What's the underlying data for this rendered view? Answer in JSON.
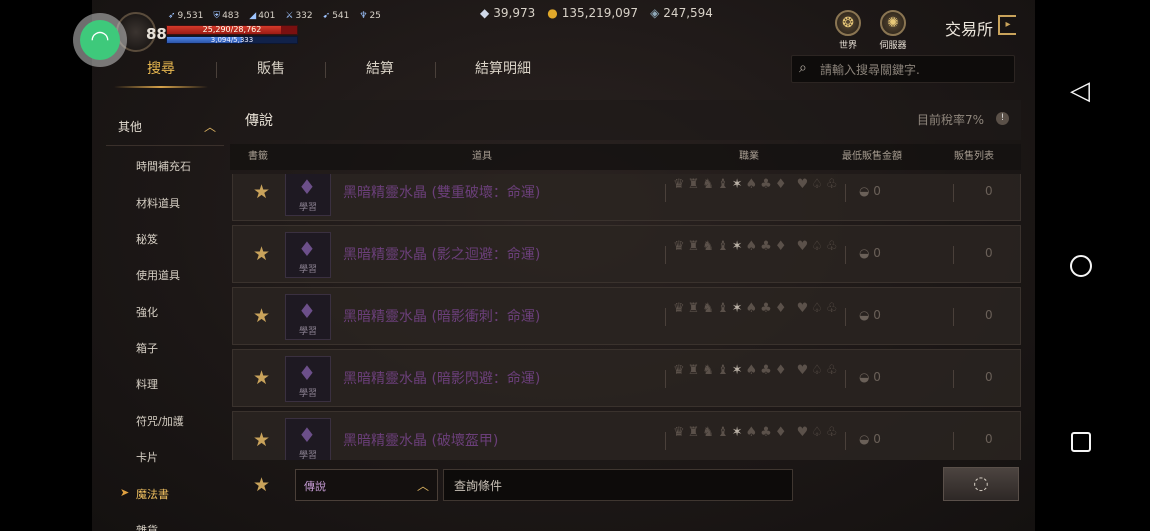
{
  "player": {
    "level": "88",
    "stats": [
      "9,531",
      "483",
      "401",
      "332",
      "541",
      "25"
    ],
    "hp_text": "25,290/28,762",
    "mp_text": "3,094/5,333",
    "hp_fraction": 0.88,
    "mp_fraction": 0.58
  },
  "currency": {
    "diamond": "39,973",
    "gold": "135,219,097",
    "gem": "247,594"
  },
  "top_right": {
    "world_label": "世界",
    "server_label": "伺服器",
    "title": "交易所"
  },
  "tabs": [
    "搜尋",
    "販售",
    "結算",
    "結算明細"
  ],
  "active_tab": 0,
  "search": {
    "placeholder": "請輸入搜尋關鍵字."
  },
  "sidebar": {
    "category": "其他",
    "items": [
      "時間補充石",
      "材料道具",
      "秘笈",
      "使用道具",
      "強化",
      "箱子",
      "料理",
      "符咒/加護",
      "卡片",
      "魔法書",
      "雜貨"
    ],
    "active_item": "魔法書"
  },
  "panel": {
    "title": "傳說",
    "tax": "目前稅率7%",
    "columns": {
      "bookmark": "書籤",
      "item": "道具",
      "class": "職業",
      "min_price": "最低販售金額",
      "listings": "販售列表"
    }
  },
  "rows": [
    {
      "name": "黑暗精靈水晶 (雙重破壞：命運)",
      "tag": "學習",
      "min_price": "0",
      "listings": "0"
    },
    {
      "name": "黑暗精靈水晶 (影之迴避：命運)",
      "tag": "學習",
      "min_price": "0",
      "listings": "0"
    },
    {
      "name": "黑暗精靈水晶 (暗影衝刺：命運)",
      "tag": "學習",
      "min_price": "0",
      "listings": "0"
    },
    {
      "name": "黑暗精靈水晶 (暗影閃避：命運)",
      "tag": "學習",
      "min_price": "0",
      "listings": "0"
    },
    {
      "name": "黑暗精靈水晶 (破壞盔甲)",
      "tag": "學習",
      "min_price": "0",
      "listings": "0"
    }
  ],
  "bottom": {
    "grade": "傳說",
    "query_placeholder": "查詢條件"
  }
}
